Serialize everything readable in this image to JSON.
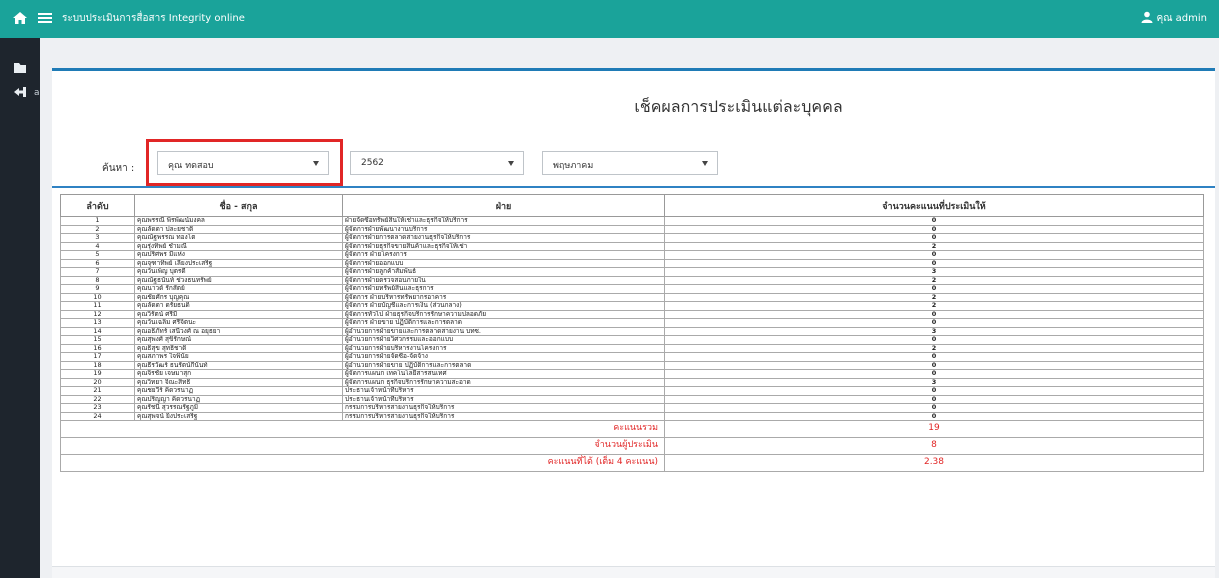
{
  "topbar": {
    "title": "ระบบประเมินการสื่อสาร Integrity online",
    "user": "คุณ admin",
    "color": "#1aa39a"
  },
  "sidebar": {
    "partial_text": "a"
  },
  "page": {
    "heading": "เช็คผลการประเมินแต่ละบุคคล",
    "search_label": "ค้นหา :",
    "name_select": "คุณ ทดสอบ",
    "year_select": "2562",
    "month_select": "พฤษภาคม"
  },
  "table": {
    "headers": [
      "ลำดับ",
      "ชื่อ - สกุล",
      "ฝ่าย",
      "จำนวนคะแนนที่ประเมินให้"
    ],
    "rows": [
      [
        "1",
        "คุณพรรณี พิรพัฒน์มงคล",
        "ฝ่ายจัดซื้อทรัพย์สินให้เช่าและธุรกิจให้บริการ",
        "0"
      ],
      [
        "2",
        "คุณลัดดา ปละยชาติ",
        "ผู้จัดการฝ่ายพัฒนางานบริการ",
        "0"
      ],
      [
        "3",
        "คุณณัฐพรรณ ทองโต",
        "ผู้จัดการฝ่ายการตลาดสายงานธุรกิจให้บริการ",
        "0"
      ],
      [
        "4",
        "คุณรุ่งทิพย์ ชำมณี",
        "ผู้จัดการฝ่ายธุรกิจขายสินค้าและธุรกิจให้เช่า",
        "2"
      ],
      [
        "5",
        "คุณปริศพร มีแห่ง",
        "ผู้จัดการ ฝ่ายโครงการ",
        "0"
      ],
      [
        "6",
        "คุณจุฑาทิพย์ เลียงประเสริฐ",
        "ผู้จัดการฝ่ายออกแบบ",
        "0"
      ],
      [
        "7",
        "คุณวันเพ็ญ บุตรดี",
        "ผู้จัดการฝ่ายลูกค้าสัมพันธ์",
        "3"
      ],
      [
        "8",
        "คุณณัฐธนันท์ ช่วงธนทรัพย์",
        "ผู้จัดการฝ่ายตรวจสอบภายใน",
        "2"
      ],
      [
        "9",
        "คุณนาวด์ รักสัตย์",
        "ผู้จัดการฝ่ายทรัพย์สินและธุรการ",
        "0"
      ],
      [
        "10",
        "คุณชัยศักร บุญคุณ",
        "ผู้จัดการ ฝ่ายบริหารทรัพยากรอาคาร",
        "2"
      ],
      [
        "11",
        "คุณลัดดา ดรัยธนดิ",
        "ผู้จัดการ ฝ่ายบัญชีและการเงิน (ส่วนกลาง)",
        "2"
      ],
      [
        "12",
        "คุณวิรัตน์ ศรีมี",
        "ผู้จัดการทั่วไป ฝ่ายธุรกิจบริการรักษาความปลอดภัย",
        "0"
      ],
      [
        "13",
        "คุณวันเฉลิม ศรีจิตนะ",
        "ผู้จัดการ ฝ่ายขาย ปฏิบัติการและการตลาด",
        "0"
      ],
      [
        "14",
        "คุณอธิภัทร์ เสนีวงศ์ ณ อยุธยา",
        "ผู้อำนวยการฝ่ายขายและการตลาดสายงาน บทซ.",
        "3"
      ],
      [
        "15",
        "คุณสุพงศ์ สุขิรักษณ์",
        "ผู้อำนวยการฝ่ายวิศวกรรมและออกแบบ",
        "0"
      ],
      [
        "16",
        "คุณธิสุข สุทธิชาติ",
        "ผู้อำนวยการฝ่ายบริหารงานโครงการ",
        "2"
      ],
      [
        "17",
        "คุณสภาพร ใจพินัย",
        "ผู้อำนวยการฝ่ายจัดซื้อ-จัดจ้าง",
        "0"
      ],
      [
        "18",
        "คุณธีรวัฒร์ ธนรัตน์กีนันท์",
        "ผู้อำนวยการฝ่ายขาย ปฏิบัติการและการตลาด",
        "0"
      ],
      [
        "19",
        "คุณจิรชัย เจษมาสุก",
        "ผู้จัดการแผนก เทคโนโลยีสารสนเทศ",
        "0"
      ],
      [
        "20",
        "คุณวิทยา จิณะสิทธิ์",
        "ผู้จัดการแผนก ธุรกิจบริการรักษาความสะอาด",
        "3"
      ],
      [
        "21",
        "คุณชยวีร์ คิดวรนาฏ",
        "ประธานเจ้าหน้าที่บริหาร",
        "0"
      ],
      [
        "22",
        "คุณปริญญา คิดวรนาฏ",
        "ประธานเจ้าหน้าที่บริหาร",
        "0"
      ],
      [
        "23",
        "คุณรัชนี สุวรรณรัฐภูมิ",
        "กรรมการบริหารสายงานธุรกิจให้บริการ",
        "0"
      ],
      [
        "24",
        "คุณสุพจน์ ยิ่งประเสริฐ",
        "กรรมการบริหารสายงานธุรกิจให้บริการ",
        "0"
      ]
    ],
    "summary": [
      {
        "label": "คะแนนรวม",
        "value": "19"
      },
      {
        "label": "จำนวนผู้ประเมิน",
        "value": "8"
      },
      {
        "label": "คะแนนที่ได้ (เต็ม 4 คะแนน)",
        "value": "2.38"
      }
    ]
  }
}
